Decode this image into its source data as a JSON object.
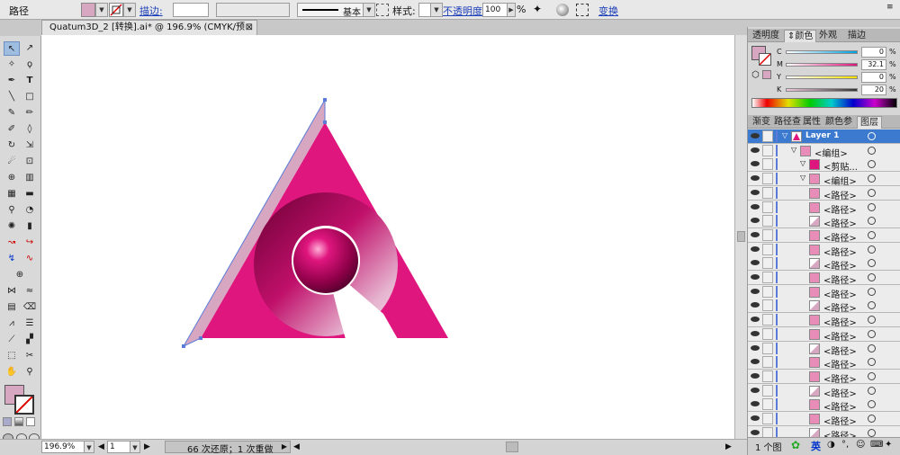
{
  "control_bar": {
    "object_type": "路径",
    "stroke_label": "描边:",
    "stroke_style": "基本",
    "style_label": "样式:",
    "opacity_label": "不透明度:",
    "opacity_value": "100",
    "opacity_unit": "%",
    "transform_label": "变换"
  },
  "document": {
    "tab_title": "Quatum3D_2 [转换].ai* @ 196.9% (CMYK/预览)",
    "zoom": "196.9%",
    "artboard_num": "1",
    "status_text": "66 次还原；1 次重做"
  },
  "color_panel": {
    "tabs": [
      "透明度",
      "颜色",
      "外观",
      "描边"
    ],
    "active_tab": "颜色",
    "channels": [
      {
        "label": "C",
        "value": "0"
      },
      {
        "label": "M",
        "value": "32.1"
      },
      {
        "label": "Y",
        "value": "0"
      },
      {
        "label": "K",
        "value": "20"
      }
    ],
    "unit": "%"
  },
  "layers_panel": {
    "tabs": [
      "渐变",
      "路径查",
      "属性",
      "颜色参",
      "图层"
    ],
    "active_tab": "图层",
    "rows": [
      {
        "name": "Layer 1",
        "indent": 0,
        "selected": true
      },
      {
        "name": "<编组>",
        "indent": 1
      },
      {
        "name": "<剪贴...",
        "indent": 2
      },
      {
        "name": "<编组>",
        "indent": 2
      },
      {
        "name": "<路径>",
        "indent": 3
      },
      {
        "name": "<路径>",
        "indent": 3
      },
      {
        "name": "<路径>",
        "indent": 3
      },
      {
        "name": "<路径>",
        "indent": 3
      },
      {
        "name": "<路径>",
        "indent": 3
      },
      {
        "name": "<路径>",
        "indent": 3
      },
      {
        "name": "<路径>",
        "indent": 3
      },
      {
        "name": "<路径>",
        "indent": 3
      },
      {
        "name": "<路径>",
        "indent": 3
      },
      {
        "name": "<路径>",
        "indent": 3
      },
      {
        "name": "<路径>",
        "indent": 3
      },
      {
        "name": "<路径>",
        "indent": 3
      },
      {
        "name": "<路径>",
        "indent": 3
      },
      {
        "name": "<路径>",
        "indent": 3
      },
      {
        "name": "<路径>",
        "indent": 3
      },
      {
        "name": "<路径>",
        "indent": 3
      },
      {
        "name": "<路径>",
        "indent": 3
      },
      {
        "name": "<路径>",
        "indent": 3
      }
    ],
    "footer": "1 个图"
  },
  "taskbar": {
    "ime": "英"
  },
  "colors": {
    "magenta": "#e0167f",
    "fill_swatch": "#d7a6c0",
    "selection": "#5a7cd8"
  }
}
